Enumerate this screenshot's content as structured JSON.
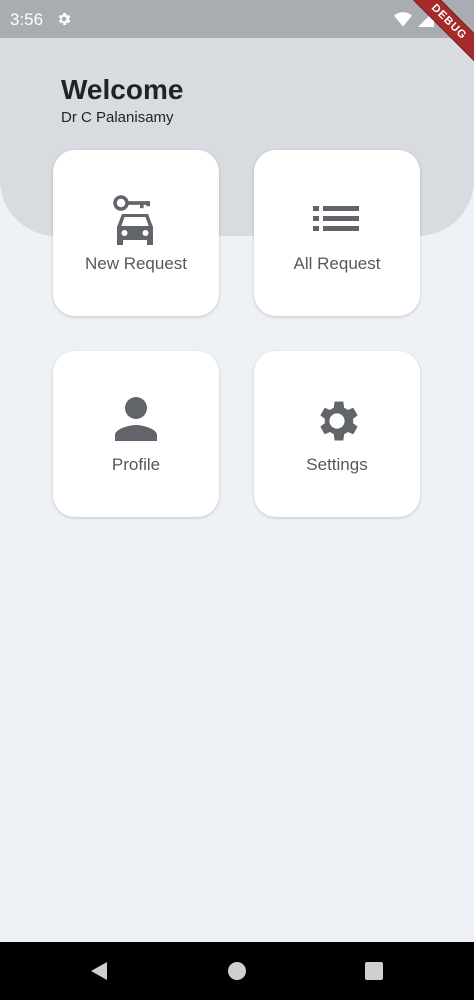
{
  "status_bar": {
    "time": "3:56"
  },
  "debug_banner": {
    "label": "DEBUG"
  },
  "header": {
    "title": "Welcome",
    "user_name": "Dr C Palanisamy"
  },
  "cards": [
    {
      "label": "New Request",
      "icon": "car-key-icon"
    },
    {
      "label": "All Request",
      "icon": "list-icon"
    },
    {
      "label": "Profile",
      "icon": "person-icon"
    },
    {
      "label": "Settings",
      "icon": "gear-icon"
    }
  ],
  "colors": {
    "header_bg": "#d8dbdf",
    "page_bg": "#eef2f6",
    "icon": "#616469",
    "debug": "#a52a2a"
  }
}
